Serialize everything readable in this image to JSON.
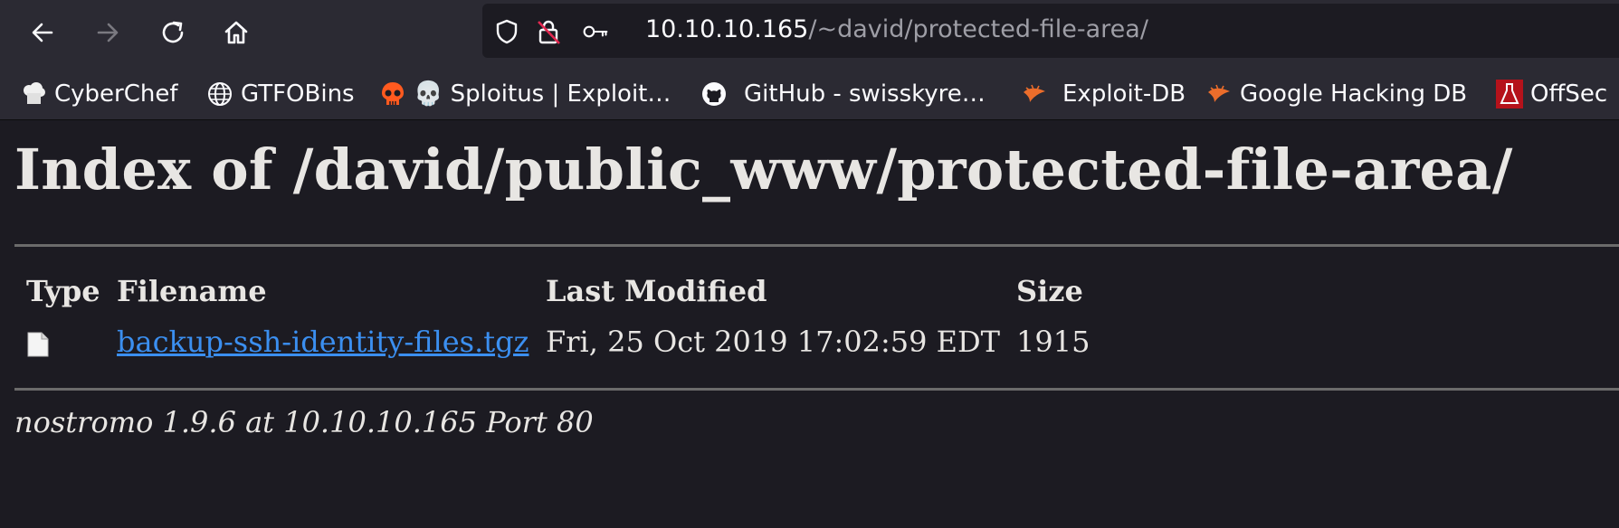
{
  "browser": {
    "url_host": "10.10.10.165",
    "url_path": "/~david/protected-file-area/",
    "nav_icons": [
      "back-icon",
      "forward-icon",
      "reload-icon",
      "home-icon"
    ],
    "url_icons": [
      "shield-icon",
      "insecure-lock-icon",
      "key-icon"
    ]
  },
  "bookmarks": [
    {
      "label": "CyberChef",
      "icon": "chef-hat-icon"
    },
    {
      "label": "GTFOBins",
      "icon": "globe-icon"
    },
    {
      "label": "💀 Sploitus | Exploit…",
      "icon": "skull-icon"
    },
    {
      "label": "GitHub - swisskyre…",
      "icon": "github-icon"
    },
    {
      "label": "Exploit-DB",
      "icon": "exploit-db-icon"
    },
    {
      "label": "Google Hacking DB",
      "icon": "exploit-db-icon"
    },
    {
      "label": "OffSec",
      "icon": "offsec-icon"
    }
  ],
  "page": {
    "title": "Index of /david/public_www/protected-file-area/",
    "columns": [
      "Type",
      "Filename",
      "Last Modified",
      "Size"
    ],
    "rows": [
      {
        "type_icon": "file-icon",
        "filename": "backup-ssh-identity-files.tgz",
        "modified": "Fri, 25 Oct 2019 17:02:59 EDT",
        "size": "1915"
      }
    ],
    "footer": "nostromo 1.9.6 at 10.10.10.165 Port 80"
  },
  "colors": {
    "link": "#3b8ff0",
    "background": "#1c1b22",
    "toolbar": "#2b2a33"
  }
}
